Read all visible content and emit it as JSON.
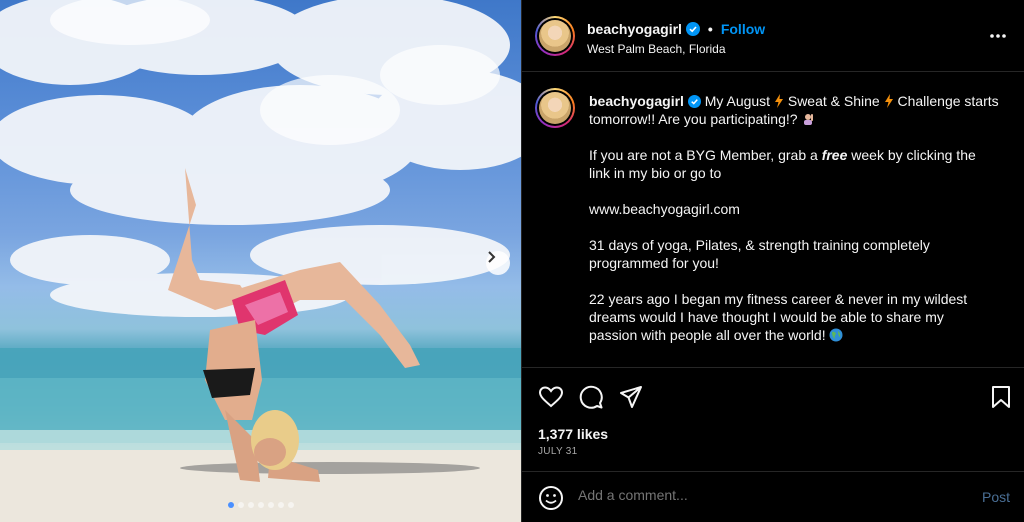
{
  "post": {
    "username": "beachyogagirl",
    "follow_label": "Follow",
    "separator": "•",
    "location": "West Palm Beach, Florida",
    "caption": {
      "username": "beachyogagirl",
      "line1a": "My August ",
      "line1b": " Sweat & Shine ",
      "line1c": " Challenge starts",
      "line2": "tomorrow!! Are you participating!? ",
      "p2a": "If you are not a BYG Member, grab a ",
      "p2free": "free",
      "p2b": " week by clicking the",
      "p2c": "link in my bio or go to",
      "url": "www.beachyogagirl.com",
      "p4a": "31 days of yoga, Pilates, & strength training completely",
      "p4b": "programmed for you!",
      "p5a": "22 years ago I began my fitness career & never in my wildest",
      "p5b": "dreams would I have thought I would be able to share my",
      "p5c": "passion with people all over the world! "
    },
    "likes": "1,377 likes",
    "date": "JULY 31",
    "comment_placeholder": "Add a comment...",
    "post_label": "Post",
    "carousel": {
      "slide_count": 7,
      "active_index": 0
    }
  },
  "icons": {
    "verified": "verified-badge-icon",
    "more": "more-options-icon",
    "like": "heart-icon",
    "comment": "comment-icon",
    "share": "share-icon",
    "save": "bookmark-icon",
    "emoji": "emoji-icon",
    "next": "chevron-right-icon"
  },
  "colors": {
    "accent": "#0095f6",
    "post_disabled": "#4a6f95",
    "muted": "#a8a8a8"
  }
}
